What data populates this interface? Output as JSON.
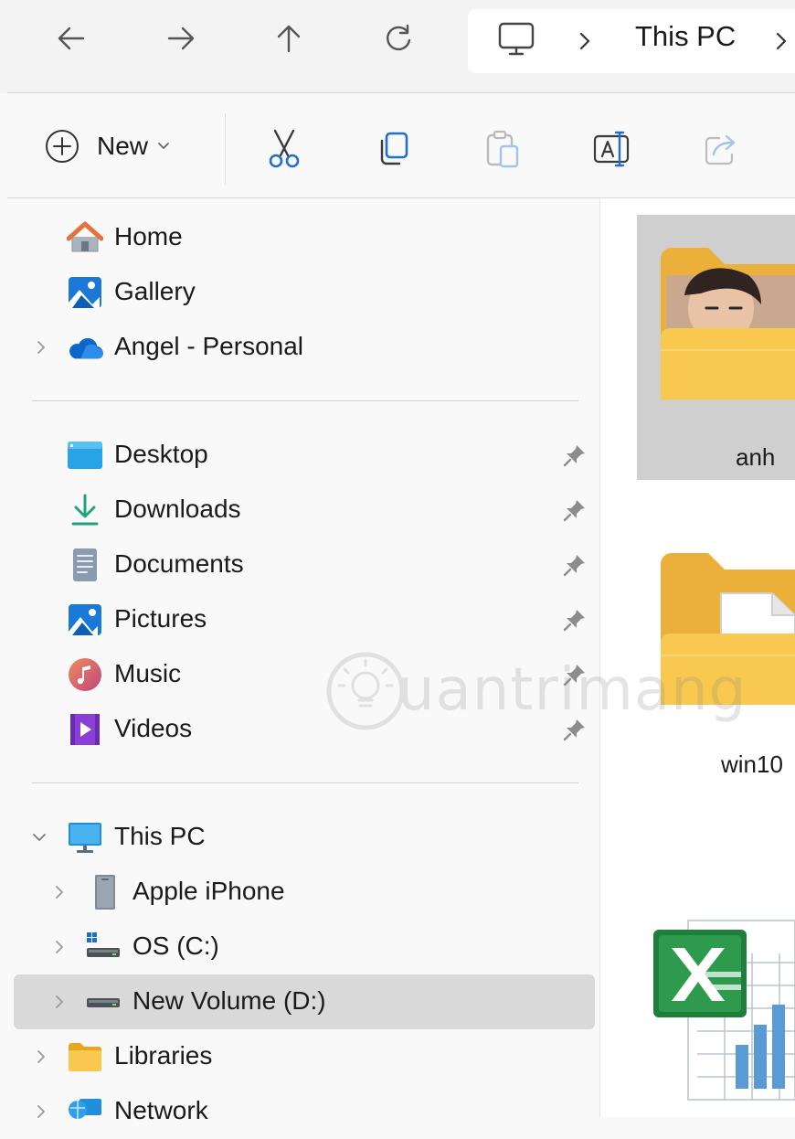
{
  "address_bar": {
    "breadcrumb": [
      "This PC"
    ],
    "icons": [
      "back-arrow-icon",
      "forward-arrow-icon",
      "up-arrow-icon",
      "refresh-icon",
      "monitor-icon",
      "chevron-right-icon"
    ]
  },
  "toolbar": {
    "new_label": "New",
    "buttons": [
      "cut-icon",
      "copy-icon",
      "paste-icon",
      "rename-icon",
      "share-icon"
    ]
  },
  "sidebar": {
    "top": [
      {
        "label": "Home",
        "icon": "home-icon"
      },
      {
        "label": "Gallery",
        "icon": "gallery-icon"
      },
      {
        "label": "Angel - Personal",
        "icon": "onedrive-cloud-icon"
      }
    ],
    "quick_access": [
      {
        "label": "Desktop",
        "icon": "desktop-folder-icon"
      },
      {
        "label": "Downloads",
        "icon": "download-icon"
      },
      {
        "label": "Documents",
        "icon": "documents-icon"
      },
      {
        "label": "Pictures",
        "icon": "pictures-icon"
      },
      {
        "label": "Music",
        "icon": "music-icon"
      },
      {
        "label": "Videos",
        "icon": "videos-icon"
      }
    ],
    "devices": [
      {
        "label": "This PC",
        "icon": "this-pc-icon",
        "expanded": true
      },
      {
        "label": "Apple iPhone",
        "icon": "phone-device-icon"
      },
      {
        "label": "OS (C:)",
        "icon": "system-drive-icon"
      },
      {
        "label": "New Volume (D:)",
        "icon": "drive-icon",
        "selected": true
      },
      {
        "label": "Libraries",
        "icon": "libraries-icon"
      },
      {
        "label": "Network",
        "icon": "network-icon"
      }
    ]
  },
  "content": {
    "items": [
      {
        "label": "anh",
        "type": "folder",
        "selected": true
      },
      {
        "label": "win10",
        "type": "folder"
      },
      {
        "label": "",
        "type": "excel-file"
      }
    ]
  },
  "watermark": "uantrimang",
  "colors": {
    "folder_yellow": "#f8c94e",
    "selection_gray": "#d9d9d9",
    "accent_blue": "#0f6cbd"
  }
}
